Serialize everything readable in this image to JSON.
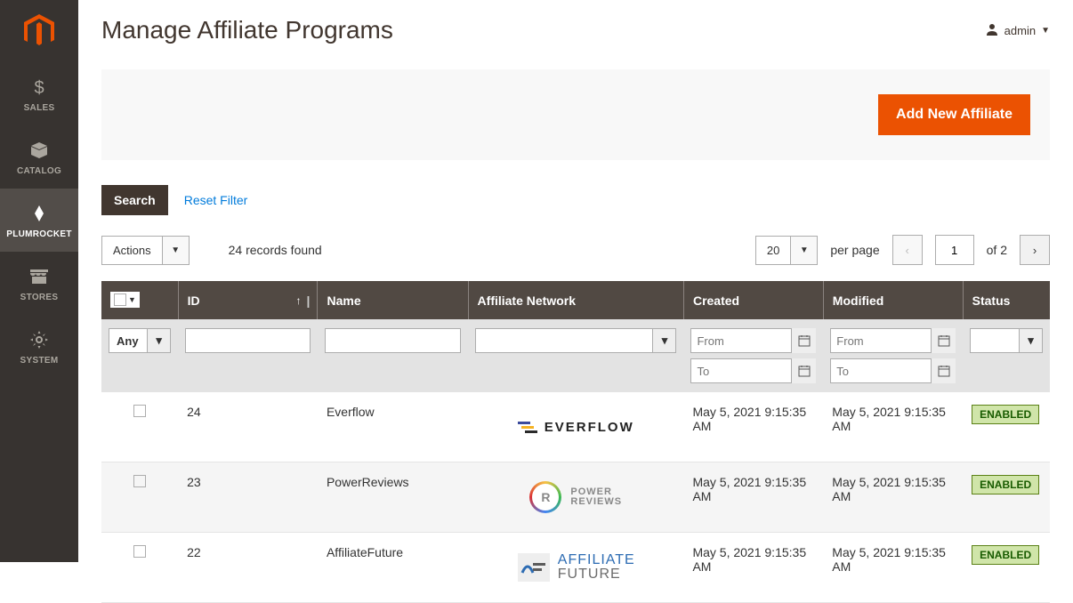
{
  "sidebar": {
    "items": [
      {
        "label": "SALES",
        "icon": "dollar"
      },
      {
        "label": "CATALOG",
        "icon": "box"
      },
      {
        "label": "PLUMROCKET",
        "icon": "plum"
      },
      {
        "label": "STORES",
        "icon": "storefront"
      },
      {
        "label": "SYSTEM",
        "icon": "gear"
      }
    ],
    "active_index": 2
  },
  "page": {
    "title": "Manage Affiliate Programs"
  },
  "user": {
    "name": "admin"
  },
  "action_bar": {
    "add_label": "Add New Affiliate"
  },
  "toolbar": {
    "search_label": "Search",
    "reset_label": "Reset Filter",
    "actions_label": "Actions",
    "records_found": "24 records found",
    "per_page_value": "20",
    "per_page_label": "per page",
    "current_page": "1",
    "total_pages": "of 2"
  },
  "columns": {
    "id": "ID",
    "name": "Name",
    "network": "Affiliate Network",
    "created": "Created",
    "modified": "Modified",
    "status": "Status"
  },
  "filters": {
    "checkbox_option": "Any",
    "from_placeholder": "From",
    "to_placeholder": "To"
  },
  "rows": [
    {
      "id": "24",
      "name": "Everflow",
      "created": "May 5, 2021 9:15:35 AM",
      "modified": "May 5, 2021 9:15:35 AM",
      "status": "ENABLED",
      "logo": "everflow"
    },
    {
      "id": "23",
      "name": "PowerReviews",
      "created": "May 5, 2021 9:15:35 AM",
      "modified": "May 5, 2021 9:15:35 AM",
      "status": "ENABLED",
      "logo": "power"
    },
    {
      "id": "22",
      "name": "AffiliateFuture",
      "created": "May 5, 2021 9:15:35 AM",
      "modified": "May 5, 2021 9:15:35 AM",
      "status": "ENABLED",
      "logo": "affuture"
    }
  ],
  "logo_text": {
    "everflow": "EVERFLOW",
    "power_l1": "POWER",
    "power_l2": "REVIEWS",
    "power_r": "R",
    "af_l1": "AFFILIATE",
    "af_l2": "FUTURE"
  },
  "colors": {
    "accent": "#eb5202",
    "sidebar_bg": "#373330",
    "table_head": "#514943",
    "link": "#007bdb",
    "badge_bg": "#d0e5a9",
    "badge_border": "#5b8116"
  }
}
